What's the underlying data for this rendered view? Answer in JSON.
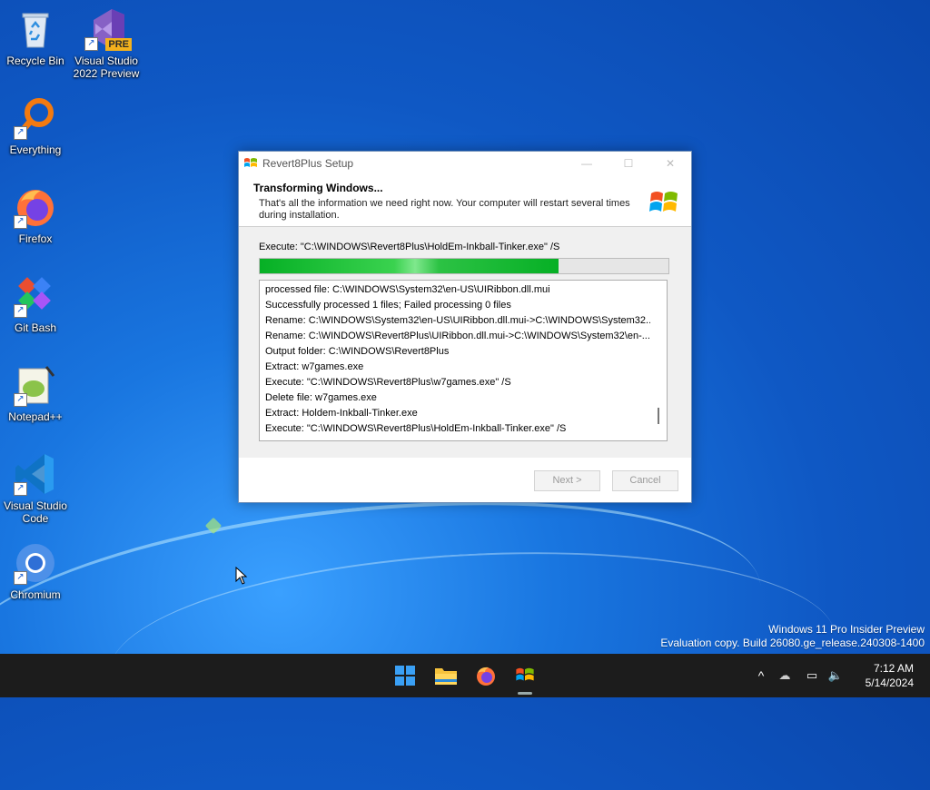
{
  "desktop": {
    "icons": [
      {
        "label": "Recycle Bin"
      },
      {
        "label": "Visual Studio 2022 Preview",
        "badge": "PRE"
      },
      {
        "label": "Everything"
      },
      {
        "label": "Firefox"
      },
      {
        "label": "Git Bash"
      },
      {
        "label": "Notepad++"
      },
      {
        "label": "Visual Studio Code"
      },
      {
        "label": "Chromium"
      }
    ]
  },
  "dialog": {
    "title": "Revert8Plus Setup",
    "header_title": "Transforming Windows...",
    "header_subtitle": "That's all the information we need right now. Your computer will restart several times during installation.",
    "execute_line": "Execute: \"C:\\WINDOWS\\Revert8Plus\\HoldEm-Inkball-Tinker.exe\" /S",
    "progress": 0.73,
    "log": [
      "processed file: C:\\WINDOWS\\System32\\en-US\\UIRibbon.dll.mui",
      "Successfully processed 1 files; Failed processing 0 files",
      "Rename: C:\\WINDOWS\\System32\\en-US\\UIRibbon.dll.mui->C:\\WINDOWS\\System32...",
      "Rename: C:\\WINDOWS\\Revert8Plus\\UIRibbon.dll.mui->C:\\WINDOWS\\System32\\en-...",
      "Output folder: C:\\WINDOWS\\Revert8Plus",
      "Extract: w7games.exe",
      "Execute: \"C:\\WINDOWS\\Revert8Plus\\w7games.exe\" /S",
      "Delete file: w7games.exe",
      "Extract: Holdem-Inkball-Tinker.exe",
      "Execute: \"C:\\WINDOWS\\Revert8Plus\\HoldEm-Inkball-Tinker.exe\" /S"
    ],
    "buttons": {
      "next": "Next >",
      "cancel": "Cancel"
    }
  },
  "watermark": {
    "line1": "Windows 11 Pro Insider Preview",
    "line2": "Evaluation copy. Build 26080.ge_release.240308-1400"
  },
  "taskbar": {
    "apps": [
      "start-icon",
      "file-explorer-icon",
      "firefox-icon",
      "revert8plus-setup-icon"
    ],
    "time": "7:12 AM",
    "date": "5/14/2024"
  },
  "colors": {
    "progress": "#06b025",
    "taskbar": "#1c1c1c",
    "desktop": "#0f58c4"
  }
}
